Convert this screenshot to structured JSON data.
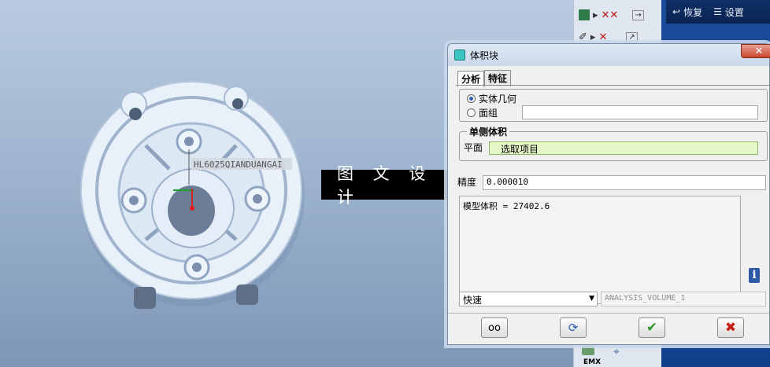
{
  "model": {
    "annotation": "HL6025QIANDUANGAI"
  },
  "watermark": "图 文 设 计",
  "blue_toolbar": {
    "undo_label": "恢复",
    "settings_label": "设置"
  },
  "toolstrip": {
    "bottom_label": "EMX"
  },
  "dialog": {
    "title": "体积块",
    "tabs": [
      {
        "label": "分析",
        "active": true
      },
      {
        "label": "特征",
        "active": false
      }
    ],
    "geometry_options": [
      {
        "label": "实体几何",
        "selected": true
      },
      {
        "label": "面组",
        "selected": false
      }
    ],
    "one_sided_group": {
      "title": "单侧体积",
      "plane_label": "平面",
      "plane_selector": "选取项目"
    },
    "precision": {
      "label": "精度",
      "value": "0.000010"
    },
    "result_text": "模型体积 = 27402.6",
    "mode_select": "快速",
    "analysis_name": "ANALYSIS_VOLUME_1"
  },
  "colors": {
    "accent_blue": "#123f8c",
    "select_green": "#e6f7c8",
    "ok_green": "#2a9a2a",
    "cancel_red": "#c8201b"
  }
}
